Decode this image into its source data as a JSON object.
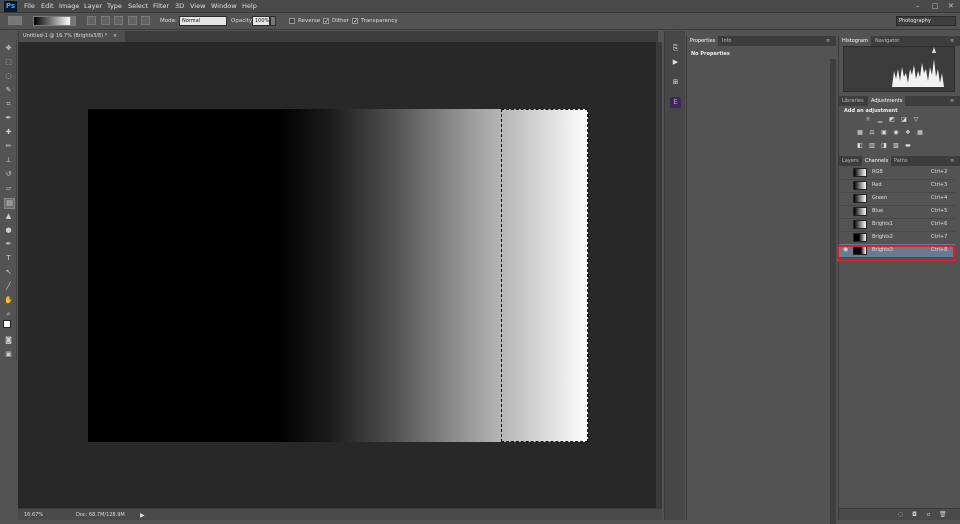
{
  "app": {
    "logo": "Ps"
  },
  "menu": [
    "File",
    "Edit",
    "Image",
    "Layer",
    "Type",
    "Select",
    "Filter",
    "3D",
    "View",
    "Window",
    "Help"
  ],
  "window_controls": {
    "minimize": "–",
    "maximize": "□",
    "close": "✕"
  },
  "options": {
    "mode_label": "Mode:",
    "mode_value": "Normal",
    "opacity_label": "Opacity:",
    "opacity_value": "100%",
    "reverse_label": "Reverse",
    "dither_label": "Dither",
    "transparency_label": "Transparency",
    "reverse_checked": false,
    "dither_checked": true,
    "transparency_checked": true,
    "workspace": "Photography"
  },
  "document": {
    "tab_title": "Untitled-1 @ 16.7% (Brights3/8) *",
    "tab_close": "×"
  },
  "status": {
    "zoom": "16.67%",
    "doc_info": "Doc: 68.7M/128.9M"
  },
  "properties": {
    "tabs": [
      "Properties",
      "Info"
    ],
    "content": "No Properties"
  },
  "histogram_panel": {
    "tabs": [
      "Histogram",
      "Navigator"
    ]
  },
  "adjustments_panel": {
    "tabs": [
      "Libraries",
      "Adjustments"
    ],
    "title": "Add an adjustment"
  },
  "channels_panel": {
    "tabs": [
      "Layers",
      "Channels",
      "Paths"
    ],
    "channels": [
      {
        "name": "RGB",
        "shortcut": "Ctrl+2"
      },
      {
        "name": "Red",
        "shortcut": "Ctrl+3"
      },
      {
        "name": "Green",
        "shortcut": "Ctrl+4"
      },
      {
        "name": "Blue",
        "shortcut": "Ctrl+5"
      },
      {
        "name": "Brights1",
        "shortcut": "Ctrl+6"
      },
      {
        "name": "Brights2",
        "shortcut": "Ctrl+7"
      },
      {
        "name": "Brights3",
        "shortcut": "Ctrl+8"
      }
    ],
    "selected_channel": "Brights3"
  },
  "icons": {
    "tools": [
      "move-icon",
      "marquee-icon",
      "lasso-icon",
      "quick-select-icon",
      "crop-icon",
      "eyedropper-icon",
      "healing-icon",
      "brush-icon",
      "stamp-icon",
      "history-brush-icon",
      "eraser-icon",
      "gradient-icon",
      "blur-icon",
      "dodge-icon",
      "pen-icon",
      "type-icon",
      "path-select-icon",
      "shape-icon",
      "hand-icon",
      "zoom-icon"
    ]
  },
  "colors": {
    "selection_highlight": "#e01c24",
    "selected_row": "#6a7a90",
    "ps_blue": "#31a8ff"
  }
}
